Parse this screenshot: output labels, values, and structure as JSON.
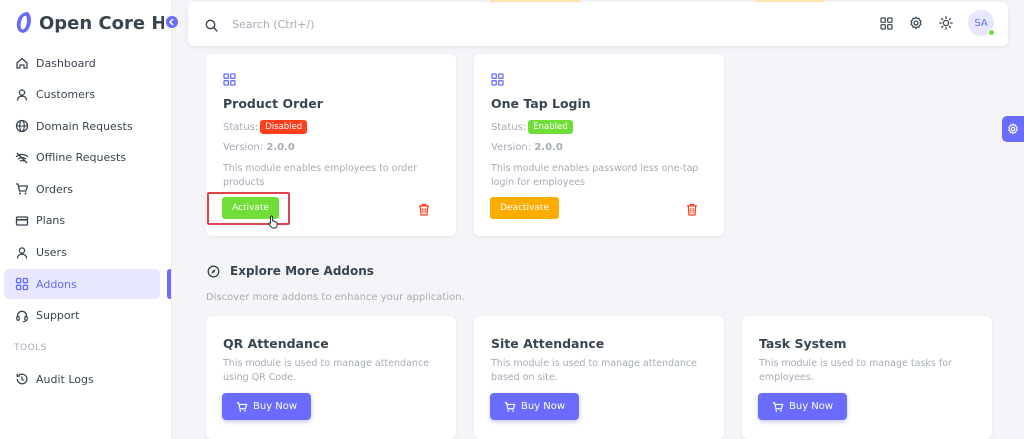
{
  "brand": {
    "name": "Open Core HR",
    "color": "#696cff"
  },
  "sidebar": {
    "items": [
      {
        "label": "Dashboard",
        "icon": "home-icon"
      },
      {
        "label": "Customers",
        "icon": "user-icon"
      },
      {
        "label": "Domain Requests",
        "icon": "globe-icon"
      },
      {
        "label": "Offline Requests",
        "icon": "wifi-off-icon"
      },
      {
        "label": "Orders",
        "icon": "cart-icon"
      },
      {
        "label": "Plans",
        "icon": "credit-card-icon"
      },
      {
        "label": "Users",
        "icon": "user-icon"
      },
      {
        "label": "Addons",
        "icon": "grid-icon",
        "active": true
      },
      {
        "label": "Support",
        "icon": "headset-icon"
      }
    ],
    "section_header": "TOOLS",
    "tools": [
      {
        "label": "Audit Logs",
        "icon": "history-icon"
      }
    ]
  },
  "navbar": {
    "search_placeholder": "Search (Ctrl+/)",
    "avatar_initials": "SA"
  },
  "addons": [
    {
      "title": "Product Order",
      "status_label": "Status:",
      "status": "Disabled",
      "status_color": "#ff3e1d",
      "version_label": "Version:",
      "version": "2.0.0",
      "description": "This module enables employees to order products",
      "action": "Activate",
      "action_color": "#71dd37"
    },
    {
      "title": "One Tap Login",
      "status_label": "Status:",
      "status": "Enabled",
      "status_color": "#71dd37",
      "version_label": "Version:",
      "version": "2.0.0",
      "description": "This module enables password less one-tap login for employees",
      "action": "Deactivate",
      "action_color": "#ffab00"
    }
  ],
  "explore": {
    "title": "Explore More Addons",
    "subtitle": "Discover more addons to enhance your application.",
    "items": [
      {
        "title": "QR Attendance",
        "description": "This module is used to manage attendance using QR Code.",
        "button": "Buy Now"
      },
      {
        "title": "Site Attendance",
        "description": "This module is used to manage attendance based on site.",
        "button": "Buy Now"
      },
      {
        "title": "Task System",
        "description": "This module is used to manage tasks for employees.",
        "button": "Buy Now"
      }
    ]
  },
  "colors": {
    "primary": "#696cff",
    "danger": "#ff3e1d",
    "success": "#71dd37",
    "warning": "#ffab00"
  }
}
